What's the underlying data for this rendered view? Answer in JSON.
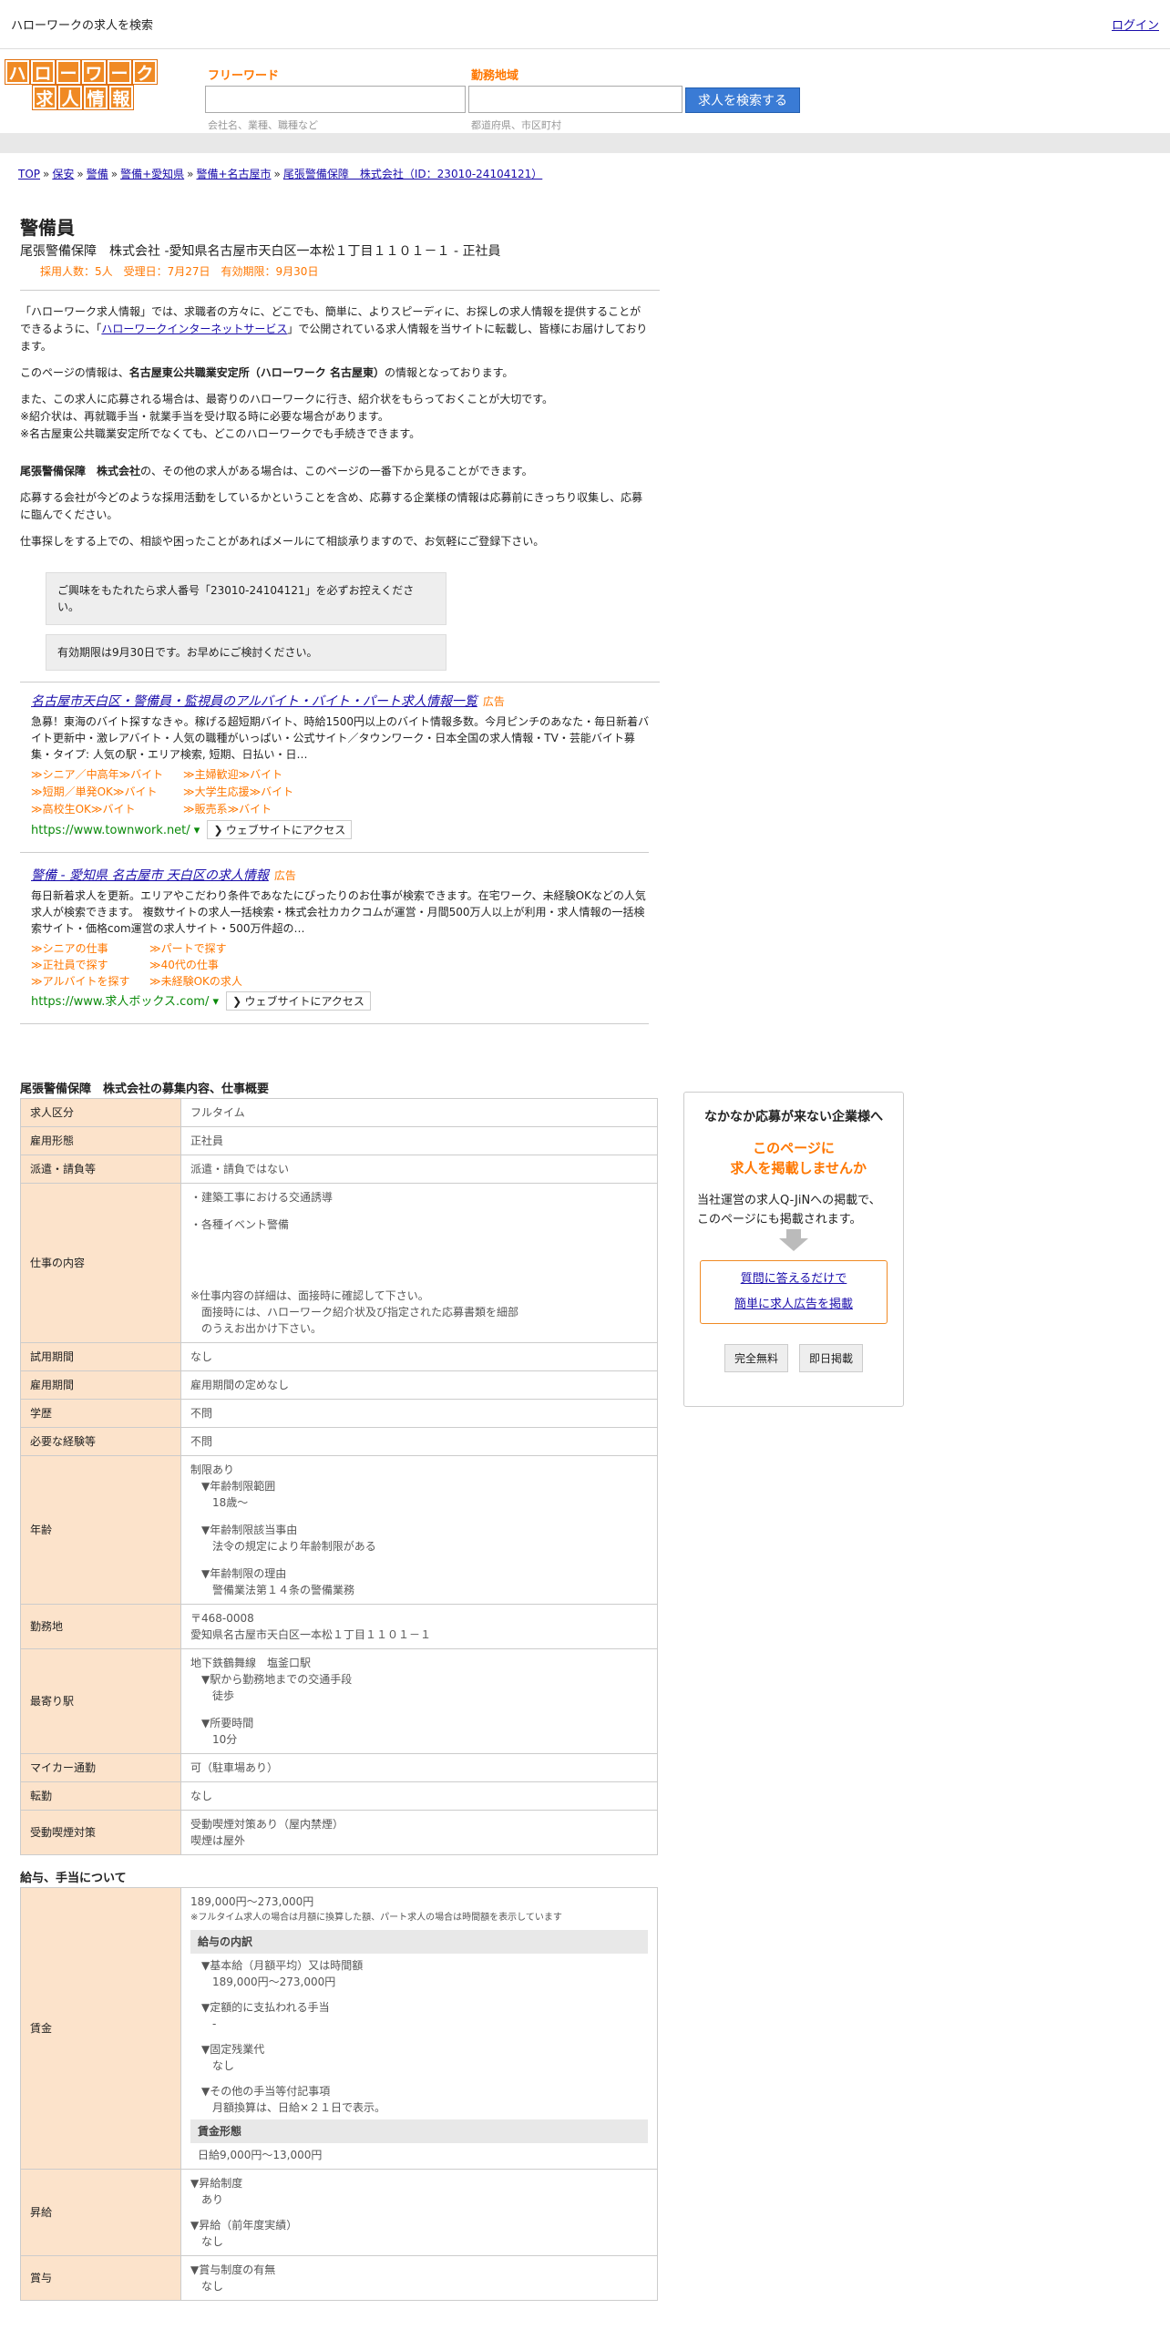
{
  "topbar": {
    "title": "ハローワークの求人を検索",
    "login": "ログイン"
  },
  "logo": {
    "line1": [
      "ハ",
      "ロ",
      "ー",
      "ワ",
      "ー",
      "ク"
    ],
    "line2": [
      "求",
      "人",
      "情",
      "報"
    ]
  },
  "search": {
    "freeword_label": "フリーワード",
    "freeword_placeholder": "会社名、業種、職種など",
    "area_label": "勤務地域",
    "area_placeholder": "都道府県、市区町村",
    "button": "求人を検索する"
  },
  "breadcrumb": [
    "TOP",
    "保安",
    "警備",
    "警備+愛知県",
    "警備+名古屋市",
    "尾張警備保障　株式会社（ID：23010-24104121）"
  ],
  "job": {
    "title": "警備員",
    "company": "尾張警備保障　株式会社 -愛知県名古屋市天白区一本松１丁目１１０１－１ - 正社員",
    "stats": "採用人数：5人　受理日：7月27日　有効期限：9月30日"
  },
  "intro": {
    "p1a": "「ハローワーク求人情報」では、求職者の方々に、どこでも、簡単に、よりスピーディに、お探しの求人情報を提供することができるように、「",
    "p1link": "ハローワークインターネットサービス",
    "p1b": "」で公開されている求人情報を当サイトに転載し、皆様にお届けしております。",
    "p2a": "このページの情報は、",
    "p2b": "名古屋東公共職業安定所（ハローワーク 名古屋東）",
    "p2c": "の情報となっております。",
    "p3": "また、この求人に応募される場合は、最寄りのハローワークに行き、紹介状をもらっておくことが大切です。",
    "p4": "※紹介状は、再就職手当・就業手当を受け取る時に必要な場合があります。",
    "p5": "※名古屋東公共職業安定所でなくても、どこのハローワークでも手続きできます。",
    "p6a": "尾張警備保障　株式会社",
    "p6b": "の、その他の求人がある場合は、このページの一番下から見ることができます。",
    "p7": "応募する会社が今どのような採用活動をしているかということを含め、応募する企業様の情報は応募前にきっちり収集し、応募に臨んでください。",
    "p8": "仕事探しをする上での、相談や困ったことがあればメールにて相談承りますので、お気軽にご登録下さい。"
  },
  "notes": [
    "ご興味をもたれたら求人番号「23010-24104121」を必ずお控えください。",
    "有効期限は9月30日です。お早めにご検討ください。"
  ],
  "ads": [
    {
      "title": "名古屋市天白区・警備員・監視員のアルバイト・バイト・パート求人情報一覧",
      "badge": "広告",
      "desc": "急募！東海のバイト探すなきゃ。稼げる超短期バイト、時給1500円以上のバイト情報多数。今月ピンチのあなた・毎日新着バイト更新中・激レアバイト・人気の職種がいっぱい・公式サイト／タウンワーク・日本全国の求人情報・TV・芸能バイト募集・タイプ: 人気の駅・エリア検索, 短期、日払い・日…",
      "links": [
        "≫シニア／中高年≫バイト",
        "≫主婦歓迎≫バイト",
        "≫短期／単発OK≫バイト",
        "≫大学生応援≫バイト",
        "≫高校生OK≫バイト",
        "≫販売系≫バイト"
      ],
      "url": "https://www.townwork.net/",
      "visit": "ウェブサイトにアクセス"
    },
    {
      "title": "警備 - 愛知県 名古屋市 天白区の求人情報",
      "badge": "広告",
      "desc": "毎日新着求人を更新。エリアやこだわり条件であなたにぴったりのお仕事が検索できます。在宅ワーク、未経験OKなどの人気求人が検索できます。 複数サイトの求人一括検索・株式会社カカクコムが運営・月間500万人以上が利用・求人情報の一括検索サイト・価格com運営の求人サイト・500万件超の…",
      "links": [
        "≫シニアの仕事",
        "≫パートで探す",
        "≫正社員で探す",
        "≫40代の仕事",
        "≫アルバイトを探す",
        "≫未経験OKの求人"
      ],
      "url": "https://www.求人ボックス.com/",
      "visit": "ウェブサイトにアクセス"
    }
  ],
  "section1": {
    "title": "尾張警備保障　株式会社の募集内容、仕事概要"
  },
  "rows": [
    {
      "k": "求人区分",
      "v": [
        "フルタイム"
      ]
    },
    {
      "k": "雇用形態",
      "v": [
        "正社員"
      ]
    },
    {
      "k": "派遣・請負等",
      "v": [
        "派遣・請負ではない"
      ]
    },
    {
      "k": "仕事の内容",
      "v": [
        "・建築工事における交通誘導",
        "",
        "・各種イベント警備",
        "",
        "",
        "",
        "",
        "",
        "※仕事内容の詳細は、面接時に確認して下さい。",
        "　面接時には、ハローワーク紹介状及び指定された応募書類を細部",
        "　のうえお出かけ下さい。"
      ]
    },
    {
      "k": "試用期間",
      "v": [
        "なし"
      ]
    },
    {
      "k": "雇用期間",
      "v": [
        "雇用期間の定めなし"
      ]
    },
    {
      "k": "学歴",
      "v": [
        "不問"
      ]
    },
    {
      "k": "必要な経験等",
      "v": [
        "不問"
      ]
    },
    {
      "k": "年齢",
      "v": [
        "制限あり",
        "　▼年齢制限範囲",
        "　　18歳〜",
        "",
        "　▼年齢制限該当事由",
        "　　法令の規定により年齢制限がある",
        "",
        "　▼年齢制限の理由",
        "　　警備業法第１４条の警備業務"
      ]
    },
    {
      "k": "勤務地",
      "v": [
        "〒468-0008",
        "愛知県名古屋市天白区一本松１丁目１１０１－１"
      ]
    },
    {
      "k": "最寄り駅",
      "v": [
        "地下鉄鶴舞線　塩釜口駅",
        "　▼駅から勤務地までの交通手段",
        "　　徒歩",
        "",
        "　▼所要時間",
        "　　10分"
      ]
    },
    {
      "k": "マイカー通勤",
      "v": [
        "可（駐車場あり）"
      ]
    },
    {
      "k": "転勤",
      "v": [
        "なし"
      ]
    },
    {
      "k": "受動喫煙対策",
      "v": [
        "受動喫煙対策あり（屋内禁煙）",
        "喫煙は屋外"
      ]
    }
  ],
  "section2": {
    "title": "給与、手当について"
  },
  "wage": {
    "k": "賃金",
    "range": "189,000円〜273,000円",
    "note": "※フルタイム求人の場合は月額に換算した額、パート求人の場合は時間額を表示しています",
    "breakdown_title": "給与の内訳",
    "breakdown": [
      "▼基本給（月額平均）又は時間額",
      "　189,000円〜273,000円",
      "",
      "▼定額的に支払われる手当",
      "　-",
      "",
      "▼固定残業代",
      "　なし",
      "",
      "▼その他の手当等付記事項",
      "　月額換算は、日給×２１日で表示。"
    ],
    "form_title": "賃金形態",
    "form": "日給9,000円〜13,000円"
  },
  "raise": {
    "k": "昇給",
    "v": [
      "▼昇給制度",
      "　あり",
      "",
      "▼昇給（前年度実績）",
      "　なし"
    ]
  },
  "bonus": {
    "k": "賞与",
    "v": [
      "▼賞与制度の有無",
      "　なし"
    ]
  },
  "sidebox": {
    "title": "なかなか応募が来ない企業様へ",
    "orange1": "このページに",
    "orange2": "求人を掲載しませんか",
    "text1": "当社運営の求人Q-JiNへの掲載で、",
    "text2": "このページにも掲載されます。",
    "link1": "質問に答えるだけで",
    "link2": "簡単に求人広告を掲載",
    "btn1": "完全無料",
    "btn2": "即日掲載"
  }
}
